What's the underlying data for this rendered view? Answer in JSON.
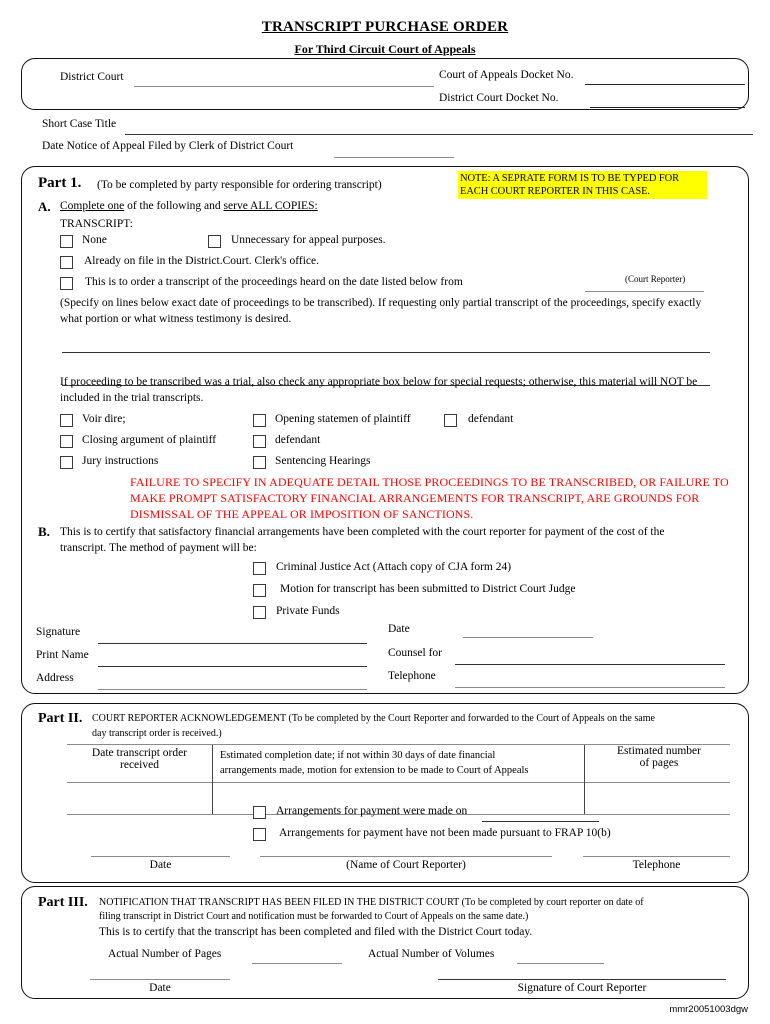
{
  "document": {
    "title": "TRANSCRIPT PURCHASE ORDER",
    "subtitle": "For Third Circuit Court of Appeals",
    "footer_code": "mmr20051003dgw"
  },
  "header": {
    "district_court_label": "District Court",
    "coa_docket_label": "Court of Appeals Docket No.",
    "dc_docket_label": "District Court Docket No.",
    "short_case_title_label": "Short Case Title",
    "date_notice_label": "Date Notice of Appeal Filed by Clerk of District Court",
    "district_court_value": "",
    "coa_docket_value": "",
    "dc_docket_value": "",
    "short_case_title_value": "",
    "date_notice_value": ""
  },
  "part1": {
    "label": "Part 1.",
    "subtitle": "(To be completed by party responsible for ordering transcript)",
    "note": {
      "line1": "NOTE: A SEPRATE FORM IS TO BE TYPED FOR",
      "line2": "EACH COURT REPORTER IN THIS CASE.",
      "highlight_color": "#ffff00"
    },
    "section_a": {
      "letter": "A.",
      "instruction_part1": "Complete one",
      "instruction_part2": " of the following and ",
      "instruction_part3": "serve ALL COPIES:",
      "transcript_label": "TRANSCRIPT:",
      "checkboxes": [
        {
          "label": "None",
          "checked": false
        },
        {
          "label": "Unnecessary for appeal purposes.",
          "checked": false
        },
        {
          "label": "Already on file in the District.Court. Clerk's office.",
          "checked": false
        },
        {
          "label": "This is to order a transcript of the proceedings heard on the date listed below from",
          "checked": false
        }
      ],
      "court_reporter_caption": "(Court Reporter)",
      "court_reporter_value": "",
      "specify_text_line1": "(Specify on lines below exact date of proceedings to be transcribed). If requesting only partial transcript of the proceedings, specify exactly",
      "specify_text_line2": "what portion or what witness testimony is desired.",
      "blank_line_1_value": "",
      "blank_line_2_value": "",
      "trial_text_line1": "If proceeding to be transcribed was a trial, also check any appropriate box below for special requests; otherwise, this material will NOT be",
      "trial_text_line2": "included in the trial transcripts.",
      "trial_checkboxes": [
        {
          "label": "Voir dire;",
          "checked": false
        },
        {
          "label": "Opening statemen of plaintiff",
          "checked": false
        },
        {
          "label": "defendant",
          "checked": false
        },
        {
          "label": "Closing argument of plaintiff",
          "checked": false
        },
        {
          "label": "defendant",
          "checked": false
        },
        {
          "label": "Jury instructions",
          "checked": false
        },
        {
          "label": "Sentencing Hearings",
          "checked": false
        }
      ]
    },
    "red_warning": {
      "line1": "FAILURE TO SPECIFY IN ADEQUATE DETAIL THOSE PROCEEDINGS TO BE TRANSCRIBED, OR FAILURE TO",
      "line2": "MAKE PROMPT SATISFACTORY FINANCIAL ARRANGEMENTS FOR TRANSCRIPT, ARE GROUNDS FOR",
      "line3": "DISMISSAL OF THE APPEAL OR IMPOSITION OF SANCTIONS.",
      "color": "#ff0000"
    },
    "section_b": {
      "letter": "B.",
      "text_line1": "This is to certify that satisfactory financial arrangements have been completed with the court reporter for payment of the cost of the",
      "text_line2": "transcript.  The method of payment will be:",
      "checkboxes": [
        {
          "label": "Criminal Justice Act (Attach copy of CJA form 24)",
          "checked": false
        },
        {
          "label": "Motion for transcript has been submitted to District Court Judge",
          "checked": false
        },
        {
          "label": "Private Funds",
          "checked": false
        }
      ]
    },
    "signature_block": {
      "signature_label": "Signature",
      "print_name_label": "Print Name",
      "address_label": "Address",
      "date_label": "Date",
      "counsel_for_label": "Counsel for",
      "telephone_label": "Telephone",
      "signature_value": "",
      "print_name_value": "",
      "address_value": "",
      "date_value": "",
      "counsel_for_value": "",
      "telephone_value": ""
    }
  },
  "part2": {
    "label": "Part II.",
    "heading_line1": "COURT REPORTER ACKNOWLEDGEMENT (To be completed by the Court Reporter and forwarded to the  Court of Appeals on the same",
    "heading_line2": "day transcript order is received.)",
    "table": {
      "headers": [
        "Date  transcript order\nreceived",
        "Estimated completion date; if not within 30 days of date financial\narrangements made, motion for extension to be made to Court of Appeals",
        "Estimated number\nof pages"
      ],
      "col1_header_line1": "Date  transcript order",
      "col1_header_line2": "received",
      "col2_header_line1": "Estimated completion date; if not within 30 days of date financial",
      "col2_header_line2": "arrangements made, motion for extension to be made to Court of Appeals",
      "col3_header_line1": "Estimated number",
      "col3_header_line2": "of pages",
      "row_values": [
        "",
        "",
        ""
      ]
    },
    "checkboxes": [
      {
        "label": "Arrangements for payment were made on",
        "checked": false,
        "has_line": true
      },
      {
        "label": "Arrangements for payment have not been made pursuant to FRAP 10(b)",
        "checked": false,
        "has_line": false
      }
    ],
    "payment_date_value": "",
    "signature_captions": {
      "date": "Date",
      "name_of_court_reporter": "(Name of Court Reporter)",
      "telephone": "Telephone"
    },
    "date_value": "",
    "reporter_name_value": "",
    "telephone_value": ""
  },
  "part3": {
    "label": "Part III.",
    "heading_line1": "NOTIFICATION THAT TRANSCRIPT HAS BEEN FILED IN THE DISTRICT COURT (To be completed by court reporter on date of",
    "heading_line2": "filing transcript in District Court and notification must be forwarded to Court of Appeals on the same date.)",
    "heading_line3": "This is to certify that the transcript has been completed and filed with the District Court today.",
    "actual_pages_label": "Actual Number of Pages",
    "actual_volumes_label": "Actual Number of Volumes",
    "actual_pages_value": "",
    "actual_volumes_value": "",
    "date_caption": "Date",
    "signature_caption": "Signature of Court Reporter",
    "date_value": "",
    "signature_value": ""
  }
}
